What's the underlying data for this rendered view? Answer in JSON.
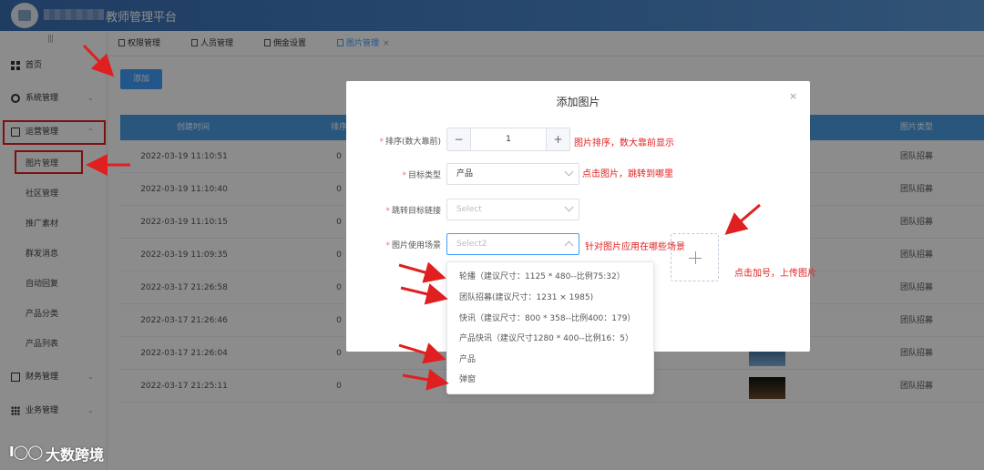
{
  "app": {
    "title": "教师管理平台"
  },
  "sidebar": {
    "collapse_glyph": "|||",
    "items": [
      {
        "label": "首页",
        "icon": "grid-icon"
      },
      {
        "label": "系统管理",
        "icon": "gear-icon"
      },
      {
        "label": "运营管理",
        "icon": "document-icon"
      },
      {
        "label": "财务管理",
        "icon": "money-icon"
      },
      {
        "label": "业务管理",
        "icon": "apps-icon"
      }
    ],
    "sub_items": [
      "图片管理",
      "社区管理",
      "推广素材",
      "群发消息",
      "自动回复",
      "产品分类",
      "产品列表"
    ]
  },
  "tabs": [
    {
      "label": "权限管理"
    },
    {
      "label": "人员管理"
    },
    {
      "label": "佣金设置"
    },
    {
      "label": "图片管理",
      "active": true
    }
  ],
  "toolbar": {
    "add_label": "添加"
  },
  "table": {
    "headers": [
      "创建时间",
      "排序",
      "图片类型"
    ],
    "rows": [
      {
        "created": "2022-03-19 11:10:51",
        "sort": "0",
        "type": "团队招募"
      },
      {
        "created": "2022-03-19 11:10:40",
        "sort": "0",
        "type": "团队招募"
      },
      {
        "created": "2022-03-19 11:10:15",
        "sort": "0",
        "type": "团队招募"
      },
      {
        "created": "2022-03-19 11:09:35",
        "sort": "0",
        "type": "团队招募"
      },
      {
        "created": "2022-03-17 21:26:58",
        "sort": "0",
        "type": "团队招募"
      },
      {
        "created": "2022-03-17 21:26:46",
        "sort": "0",
        "type": "团队招募"
      },
      {
        "created": "2022-03-17 21:26:04",
        "sort": "0",
        "extra": "1",
        "type": "团队招募"
      },
      {
        "created": "2022-03-17 21:25:11",
        "sort": "0",
        "extra": "1",
        "type": "团队招募"
      }
    ]
  },
  "dialog": {
    "title": "添加图片",
    "close": "×",
    "sort": {
      "label": "排序(数大靠前)",
      "value": "1",
      "minus": "−",
      "plus": "+"
    },
    "target_type": {
      "label": "目标类型",
      "value": "产品"
    },
    "target_link": {
      "label": "跳转目标链接",
      "placeholder": "Select"
    },
    "scene": {
      "label": "图片使用场景",
      "placeholder": "Select2"
    }
  },
  "dropdown": {
    "options": [
      "轮播（建议尺寸：1125 * 480--比例75:32）",
      "团队招募(建议尺寸：1231 × 1985)",
      "快讯（建议尺寸：800 * 358--比例400：179）",
      "产品快讯（建议尺寸1280 * 400--比例16：5）",
      "产品",
      "弹窗"
    ]
  },
  "annotations": {
    "sort_note": "图片排序，数大靠前显示",
    "target_note": "点击图片，跳转到哪里",
    "scene_note": "针对图片应用在哪些场景",
    "upload_note": "点击加号，上传图片"
  },
  "watermark": {
    "logo": "I◯◯",
    "text": "大数跨境"
  },
  "colors": {
    "primary": "#409eff",
    "header": "#4a86c8",
    "table_head": "#4a9de4",
    "annotation": "#e02020"
  }
}
